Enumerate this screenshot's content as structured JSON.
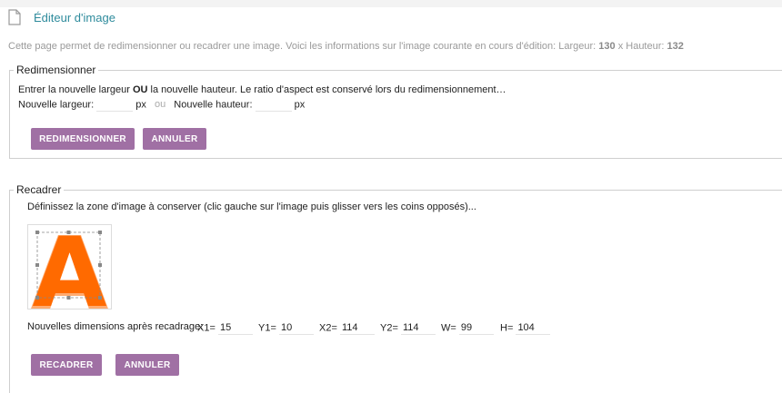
{
  "header": {
    "title": "Éditeur d'image"
  },
  "intro": {
    "text": "Cette page permet de redimensionner ou recadrer une image. Voici les informations sur l'image courante en cours d'édition: Largeur: ",
    "width": "130",
    "sep": " x Hauteur: ",
    "height": "132"
  },
  "resize": {
    "legend": "Redimensionner",
    "instr_start": "Entrer la nouvelle largeur ",
    "instr_ou": "OU",
    "instr_end": " la nouvelle hauteur. Le ratio d'aspect est conservé lors du redimensionnement…",
    "width_label": "Nouvelle largeur:",
    "width_value": "",
    "px1": "px",
    "ou": "ou",
    "height_label": "Nouvelle hauteur:",
    "height_value": "",
    "px2": "px",
    "resize_button": "REDIMENSIONNER",
    "cancel_button": "ANNULER"
  },
  "crop": {
    "legend": "Recadrer",
    "instr": "Définissez la zone d'image à conserver (clic gauche sur l'image puis glisser vers les coins opposés)...",
    "image_letter": "A",
    "dims_label": "Nouvelles dimensions après recadrage:",
    "x1_label": "X1=",
    "x1": "15",
    "y1_label": "Y1=",
    "y1": "10",
    "x2_label": "X2=",
    "x2": "114",
    "y2_label": "Y2=",
    "y2": "114",
    "w_label": "W=",
    "w": "99",
    "h_label": "H=",
    "h": "104",
    "crop_button": "RECADRER",
    "cancel_button": "ANNULER",
    "colors": {
      "letter": "#ff6a00",
      "handle": "#888888"
    }
  },
  "colors": {
    "accent": "#a070a4",
    "title": "#2e8b9c"
  },
  "icons": {
    "header": "document-icon"
  }
}
